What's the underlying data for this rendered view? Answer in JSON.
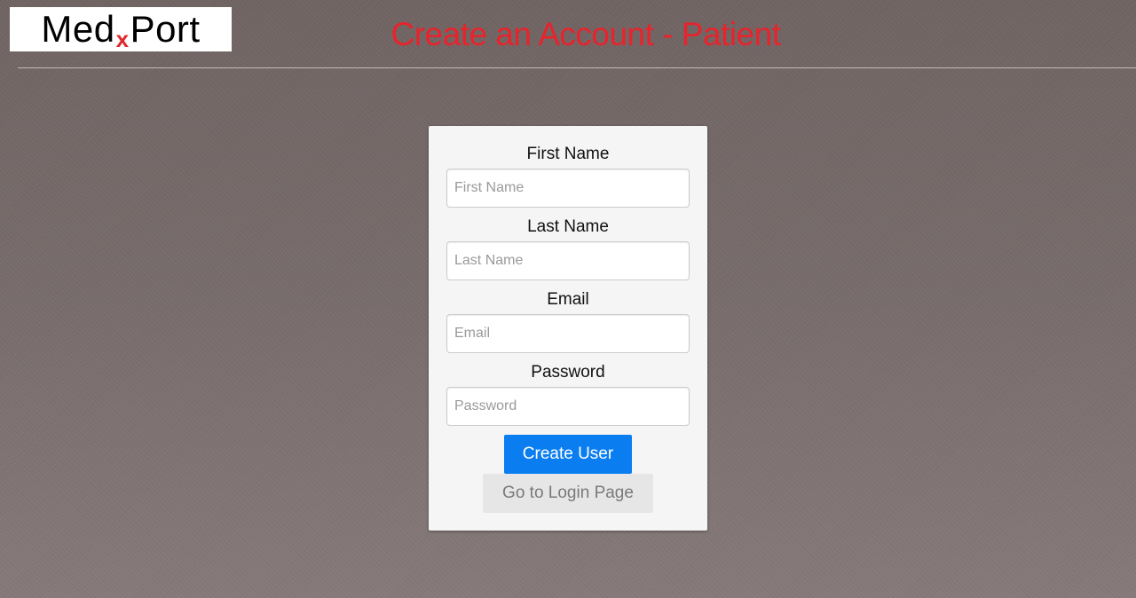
{
  "header": {
    "logo": {
      "part1": "Med",
      "x": "x",
      "part2": "Port"
    },
    "title": "Create an Account - Patient"
  },
  "form": {
    "first_name": {
      "label": "First Name",
      "placeholder": "First Name",
      "value": ""
    },
    "last_name": {
      "label": "Last Name",
      "placeholder": "Last Name",
      "value": ""
    },
    "email": {
      "label": "Email",
      "placeholder": "Email",
      "value": ""
    },
    "password": {
      "label": "Password",
      "placeholder": "Password",
      "value": ""
    },
    "create_button": "Create User",
    "login_button": "Go to Login Page"
  },
  "colors": {
    "title": "#e8232b",
    "logo_x": "#e0282c",
    "primary_button": "#0a7ef0",
    "secondary_button": "#e6e6e6",
    "card_background": "#f5f5f5"
  }
}
